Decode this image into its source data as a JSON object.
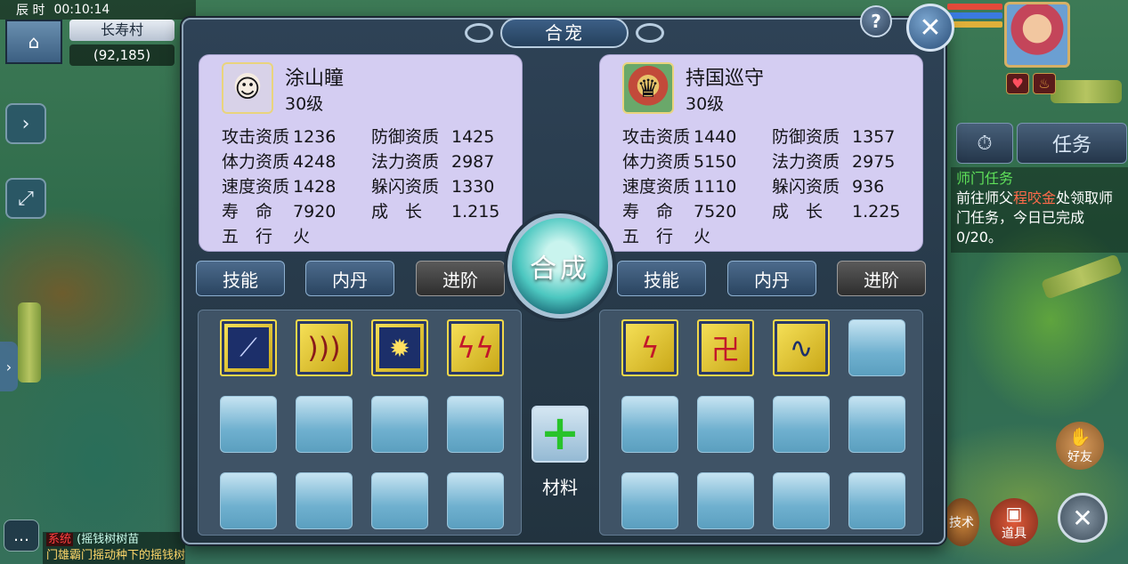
{
  "hud": {
    "time_label": "辰 时",
    "clock": "00:10:14",
    "map_name": "长寿村",
    "coords": "(92,185)"
  },
  "dialog": {
    "title": "合宠",
    "help": "?",
    "close": "✕",
    "merge_label": "合成",
    "material_label": "材料",
    "material_icon": "+"
  },
  "left_pet": {
    "name": "涂山瞳",
    "level": "30级",
    "portrait_icon": "cat-girl-portrait",
    "stats": [
      [
        "攻击资质",
        "1236",
        "防御资质",
        "1425"
      ],
      [
        "体力资质",
        "4248",
        "法力资质",
        "2987"
      ],
      [
        "速度资质",
        "1428",
        "躲闪资质",
        "1330"
      ],
      [
        "寿　命",
        "7920",
        "成　长",
        "1.215"
      ],
      [
        "五　行",
        "火",
        "",
        ""
      ]
    ],
    "tabs": [
      "技能",
      "内丹",
      "进阶"
    ],
    "skill_icons": [
      "spear-skill",
      "wave-skill",
      "thunder-burst-skill",
      "lightning-fire-skill"
    ]
  },
  "right_pet": {
    "name": "持国巡守",
    "level": "30级",
    "portrait_icon": "guardian-portrait",
    "stats": [
      [
        "攻击资质",
        "1440",
        "防御资质",
        "1357"
      ],
      [
        "体力资质",
        "5150",
        "法力资质",
        "2975"
      ],
      [
        "速度资质",
        "1110",
        "躲闪资质",
        "936"
      ],
      [
        "寿　命",
        "7520",
        "成　长",
        "1.225"
      ],
      [
        "五　行",
        "火",
        "",
        ""
      ]
    ],
    "tabs": [
      "技能",
      "内丹",
      "进阶"
    ],
    "skill_icons": [
      "lightning-skill",
      "rune-skill",
      "dragon-skill"
    ]
  },
  "right_hud": {
    "task_button": "任务",
    "quest_title": "师门任务",
    "quest_text_1": "前往师父",
    "quest_npc": "程咬金",
    "quest_text_2": "处领取师门任务，今日已完成0/20。",
    "friends": "好友",
    "items": "道具",
    "skills_short": "技术"
  },
  "chat": {
    "tag": "系统",
    "line1": "(摇钱树树苗",
    "line2": "门雄霸门摇动种下的摇钱树意外收"
  },
  "colors": {
    "dialog_bg": "#2e4256",
    "card_bg": "#d4cdf2",
    "quest_title": "#5fe05a",
    "npc_name": "#ff6a4a"
  }
}
